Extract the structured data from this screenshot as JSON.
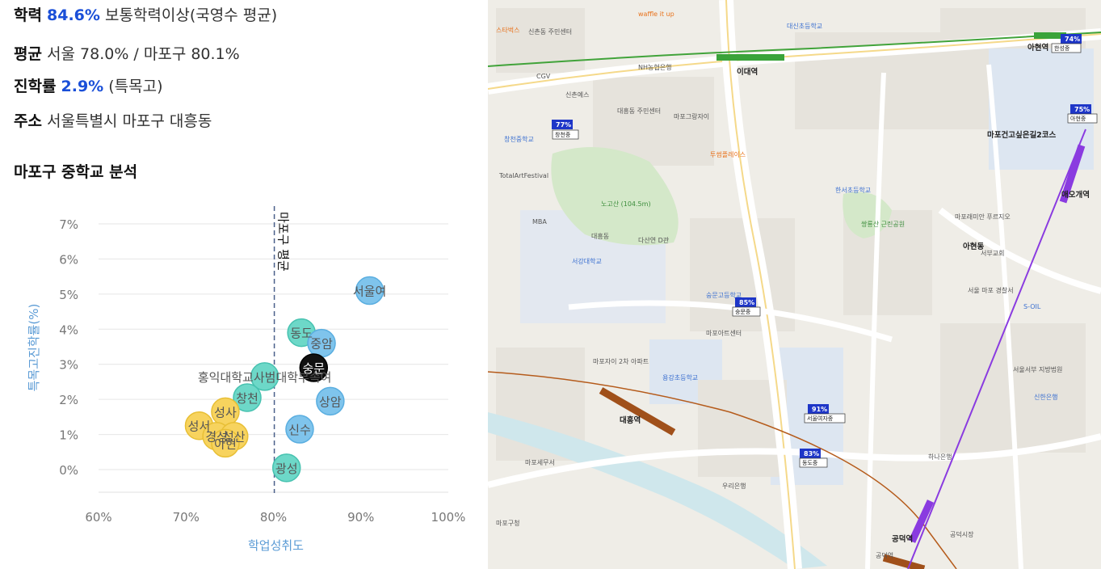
{
  "info": {
    "achievement": {
      "label": "학력",
      "value": "84.6%",
      "suffix": "보통학력이상(국영수 평균)"
    },
    "average": {
      "label": "평균",
      "text": "서울 78.0% / 마포구 80.1%"
    },
    "advancement": {
      "label": "진학률",
      "value": "2.9%",
      "suffix": "(특목고)"
    },
    "address": {
      "label": "주소",
      "text": "서울특별시 마포구 대흥동"
    }
  },
  "section_title": "마포구 중학교 분석",
  "chart_data": {
    "type": "scatter",
    "xlabel": "학업성취도",
    "ylabel": "특목고진학률(%)",
    "xlim": [
      60,
      100
    ],
    "ylim": [
      0,
      7
    ],
    "x_ticks": [
      "60%",
      "70%",
      "80%",
      "90%",
      "100%"
    ],
    "y_ticks": [
      "0%",
      "1%",
      "2%",
      "3%",
      "4%",
      "5%",
      "6%",
      "7%"
    ],
    "reference_line": {
      "x": 80.1,
      "label": "마포구 평균"
    },
    "grid": true,
    "colors": {
      "blue": "#7fc4ec",
      "teal": "#6dd8c8",
      "yellow": "#f7d35e",
      "black": "#111111"
    },
    "points": [
      {
        "name": "서울여",
        "x": 91.0,
        "y": 5.1,
        "color": "blue"
      },
      {
        "name": "동도",
        "x": 83.2,
        "y": 3.9,
        "color": "teal"
      },
      {
        "name": "중암",
        "x": 85.5,
        "y": 3.6,
        "color": "blue"
      },
      {
        "name": "숭문",
        "x": 84.6,
        "y": 2.9,
        "color": "black"
      },
      {
        "name": "홍익대학교사범대학부속여",
        "x": 79.0,
        "y": 2.65,
        "color": "teal"
      },
      {
        "name": "상암",
        "x": 86.5,
        "y": 1.95,
        "color": "blue"
      },
      {
        "name": "창천",
        "x": 77.0,
        "y": 2.05,
        "color": "teal"
      },
      {
        "name": "성사",
        "x": 74.5,
        "y": 1.65,
        "color": "yellow"
      },
      {
        "name": "신수",
        "x": 83.0,
        "y": 1.15,
        "color": "blue"
      },
      {
        "name": "성서",
        "x": 71.5,
        "y": 1.25,
        "color": "yellow"
      },
      {
        "name": "경성",
        "x": 73.5,
        "y": 0.95,
        "color": "yellow"
      },
      {
        "name": "성산",
        "x": 75.5,
        "y": 0.95,
        "color": "yellow"
      },
      {
        "name": "아현",
        "x": 74.5,
        "y": 0.75,
        "color": "yellow"
      },
      {
        "name": "광성",
        "x": 81.5,
        "y": 0.05,
        "color": "teal"
      }
    ]
  },
  "map": {
    "stations": [
      "이대역",
      "대흥역",
      "아현역",
      "애오개역",
      "공덕역"
    ],
    "school_badges": [
      {
        "pct": "77%",
        "name": "창천중"
      },
      {
        "pct": "85%",
        "name": "숭문중"
      },
      {
        "pct": "91%",
        "name": "서울여자중"
      },
      {
        "pct": "83%",
        "name": "동도중"
      },
      {
        "pct": "74%",
        "name": "한성중"
      },
      {
        "pct": "75%",
        "name": "아현중"
      }
    ],
    "labels": [
      "waffle it up",
      "신촌동 주민센터",
      "NH농협은행",
      "CGV",
      "신촌예스",
      "대흥동 주민센터",
      "마포그랑자이",
      "대신초등학교",
      "창천중학교",
      "TotalArtFestival",
      "노고산 (104.5m)",
      "MBA",
      "대흥동",
      "다산연 D관",
      "서강대학교",
      "한서초등학교",
      "쌍룡산 근린공원",
      "마포래미안 푸르지오",
      "아현동",
      "서부교회",
      "마포건고싶은길2코스",
      "스타벅스",
      "투썸플레이스",
      "숭문고등학교",
      "마포아트센터",
      "서울 마포 경찰서",
      "S-OIL",
      "서울서부 지방법원",
      "마포세무서",
      "용강초등학교",
      "우리은행",
      "하나은행",
      "공덕시장",
      "마포구청",
      "신한은행",
      "공덕역",
      "마포자이 2차 아파트"
    ]
  }
}
